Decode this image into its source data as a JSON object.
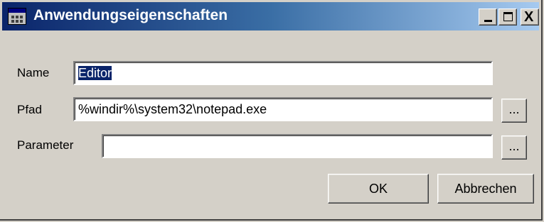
{
  "window": {
    "title": "Anwendungseigenschaften",
    "controls": {
      "minimize_icon": "minimize-icon",
      "maximize_icon": "maximize-icon",
      "close_label": "X"
    }
  },
  "form": {
    "name_label": "Name",
    "name_value": "Editor",
    "path_label": "Pfad",
    "path_value": "%windir%\\system32\\notepad.exe",
    "path_browse_label": "...",
    "parameter_label": "Parameter",
    "parameter_value": "",
    "parameter_browse_label": "..."
  },
  "buttons": {
    "ok_label": "OK",
    "cancel_label": "Abbrechen"
  },
  "colors": {
    "title_gradient_start": "#0a246a",
    "title_gradient_end": "#a6caf0",
    "dialog_background": "#d4d0c8",
    "selection": "#0a246a"
  }
}
